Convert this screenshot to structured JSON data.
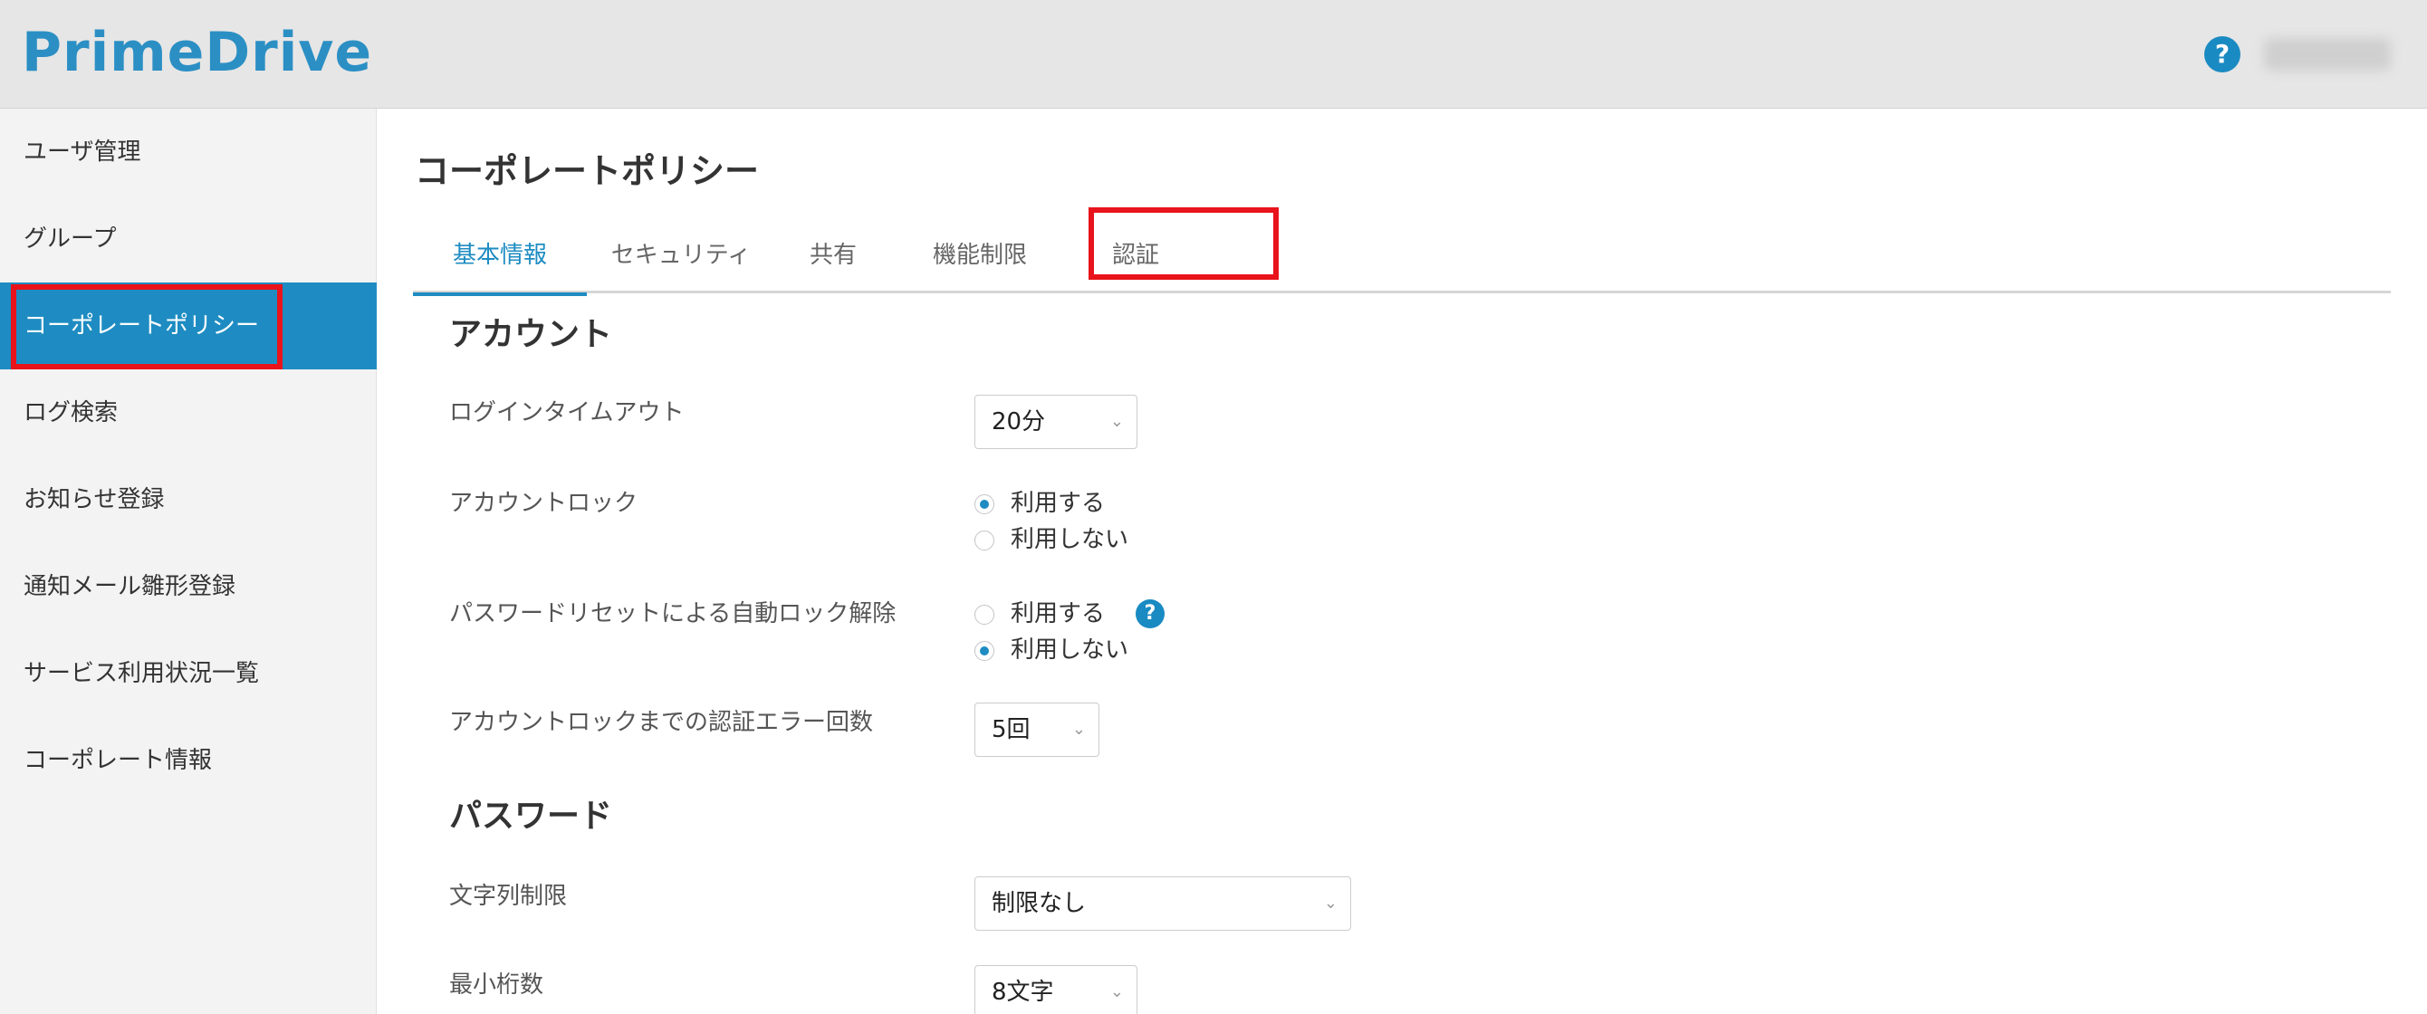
{
  "app": {
    "logo_text": "PrimeDrive",
    "help_icon": "question-circle-icon",
    "help_glyph": "?",
    "brand_color": "#1e8cc2"
  },
  "sidebar": {
    "items": [
      {
        "label": "ユーザ管理"
      },
      {
        "label": "グループ"
      },
      {
        "label": "コーポレートポリシー",
        "active": true
      },
      {
        "label": "ログ検索"
      },
      {
        "label": "お知らせ登録"
      },
      {
        "label": "通知メール雛形登録"
      },
      {
        "label": "サービス利用状況一覧"
      },
      {
        "label": "コーポレート情報"
      }
    ]
  },
  "main": {
    "title": "コーポレートポリシー",
    "tabs": [
      {
        "label": "基本情報",
        "active": true
      },
      {
        "label": "セキュリティ"
      },
      {
        "label": "共有"
      },
      {
        "label": "機能制限"
      },
      {
        "label": "認証"
      }
    ],
    "account_section": {
      "heading": "アカウント",
      "login_timeout": {
        "label": "ログインタイムアウト",
        "value": "20分"
      },
      "account_lock": {
        "label": "アカウントロック",
        "options": [
          "利用する",
          "利用しない"
        ],
        "selected": "利用する"
      },
      "password_reset_unlock": {
        "label": "パスワードリセットによる自動ロック解除",
        "options": [
          "利用する",
          "利用しない"
        ],
        "selected": "利用しない",
        "help_glyph": "?"
      },
      "auth_error_count": {
        "label": "アカウントロックまでの認証エラー回数",
        "value": "5回"
      }
    },
    "password_section": {
      "heading": "パスワード",
      "char_restriction": {
        "label": "文字列制限",
        "value": "制限なし"
      },
      "min_length": {
        "label": "最小桁数",
        "value": "8文字"
      }
    }
  },
  "chevron_glyph": "⌄",
  "highlight_color": "#e8131b"
}
